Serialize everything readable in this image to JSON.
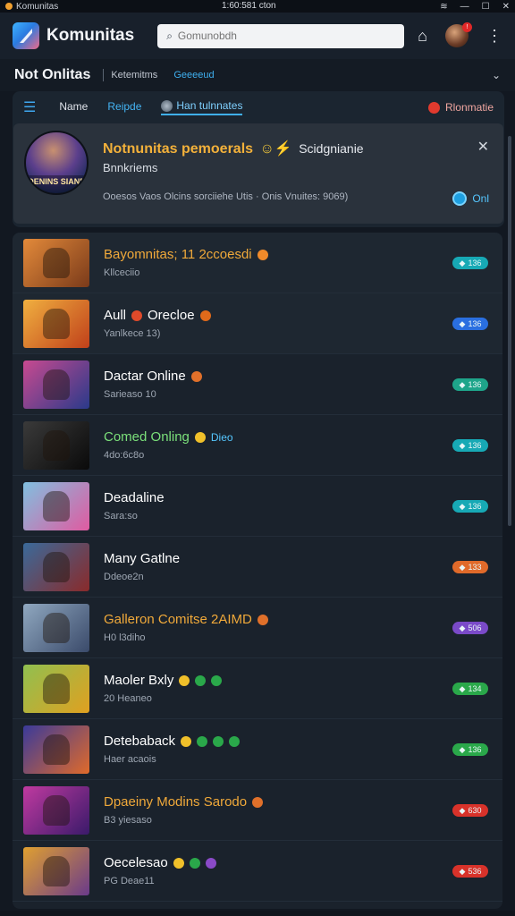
{
  "window": {
    "app_name": "Komunitas",
    "center_title": "1:60:581 cton"
  },
  "appbar": {
    "brand": "Komunitas",
    "search_placeholder": "Gomunobdh"
  },
  "subhead": {
    "title": "Not Onlitas",
    "crumb": "Ketemitms",
    "crumb2": "Geeeeud"
  },
  "tabs": {
    "name": "Name",
    "blue": "Reipde",
    "active": "Han tulnnates",
    "right": "Rlonmatie"
  },
  "notice": {
    "thumb_text": "OENINS SIANE",
    "title": "Notnunitas pemoerals",
    "title_suffix": "Scidgnianie",
    "subtitle": "Bnnkriems",
    "detail": "Ooesos Vaos Olcins sorciiehe Utis  ·  Onis  Vnuites: 9069)",
    "online_label": "Onl"
  },
  "games": [
    {
      "name": "Bayomnitas; 11 2ccoesdi",
      "sub": "Kllceciio",
      "pill": "136",
      "name_color": "#f0a93a",
      "pill_color": "#17a9b5",
      "thumb": [
        "#e38a3a",
        "#7a3a1a"
      ],
      "coins": [
        "#f08a2a"
      ]
    },
    {
      "name": "Aull",
      "name2": "Orecloe",
      "sub": "Yanlkece 13)",
      "pill": "136",
      "name_color": "#ffffff",
      "pill_color": "#2a6fe0",
      "thumb": [
        "#f0b040",
        "#c0401a"
      ],
      "coins": [
        "#e04a2a",
        "#e06a1a"
      ]
    },
    {
      "name": "Dactar Online",
      "sub": "Sarieaso 10",
      "pill": "136",
      "name_color": "#ffffff",
      "pill_color": "#1ea58a",
      "thumb": [
        "#c84a90",
        "#2a3a8a"
      ],
      "coins": [
        "#e0702a"
      ]
    },
    {
      "name": "Comed Onling",
      "name2": "Dieo",
      "sub": "4do:6c8o",
      "pill": "136",
      "name_color": "#7be07a",
      "pill_color": "#17a9b5",
      "thumb": [
        "#3a3a3a",
        "#0a0a0a"
      ],
      "coins": [
        "#f0c02a"
      ]
    },
    {
      "name": "Deadaline",
      "sub": "Sara:so",
      "pill": "136",
      "name_color": "#ffffff",
      "pill_color": "#17a9b5",
      "thumb": [
        "#80c0e0",
        "#e05aa0"
      ],
      "coins": []
    },
    {
      "name": "Many Gatlne",
      "sub": "Ddeoe2n",
      "pill": "133",
      "name_color": "#ffffff",
      "pill_color": "#e06a2a",
      "thumb": [
        "#3a6a9a",
        "#8a2a2a"
      ],
      "coins": []
    },
    {
      "name": "Galleron Comitse 2AIMD",
      "sub": "H0 l3diho",
      "pill": "506",
      "name_color": "#f0a93a",
      "pill_color": "#7a4ac8",
      "thumb": [
        "#90a8c0",
        "#3a4a6a"
      ],
      "coins": [
        "#e0702a"
      ]
    },
    {
      "name": "Maoler Bxly",
      "sub": "20 Heaneo",
      "pill": "134",
      "name_color": "#ffffff",
      "pill_color": "#2aa84a",
      "thumb": [
        "#90c050",
        "#e0a020"
      ],
      "coins": [
        "#f0c02a",
        "#2aa84a",
        "#2aa84a"
      ]
    },
    {
      "name": "Detebaback",
      "sub": "Haer acaois",
      "pill": "136",
      "name_color": "#ffffff",
      "pill_color": "#2aa84a",
      "thumb": [
        "#3a3a9a",
        "#e06a2a"
      ],
      "coins": [
        "#f0c02a",
        "#2aa84a",
        "#2aa84a",
        "#2aa84a"
      ]
    },
    {
      "name": "Dpaeiny Modins Sarodo",
      "sub": "B3 yiesaso",
      "pill": "630",
      "name_color": "#f0a93a",
      "pill_color": "#d8322a",
      "thumb": [
        "#c03aa0",
        "#3a1a6a"
      ],
      "coins": [
        "#e0702a"
      ]
    },
    {
      "name": "Oecelesao",
      "sub": "PG Deae11",
      "pill": "536",
      "name_color": "#ffffff",
      "pill_color": "#d8322a",
      "thumb": [
        "#e0a030",
        "#6a3a8a"
      ],
      "coins": [
        "#f0c02a",
        "#2aa84a",
        "#8a4ac8"
      ]
    }
  ]
}
